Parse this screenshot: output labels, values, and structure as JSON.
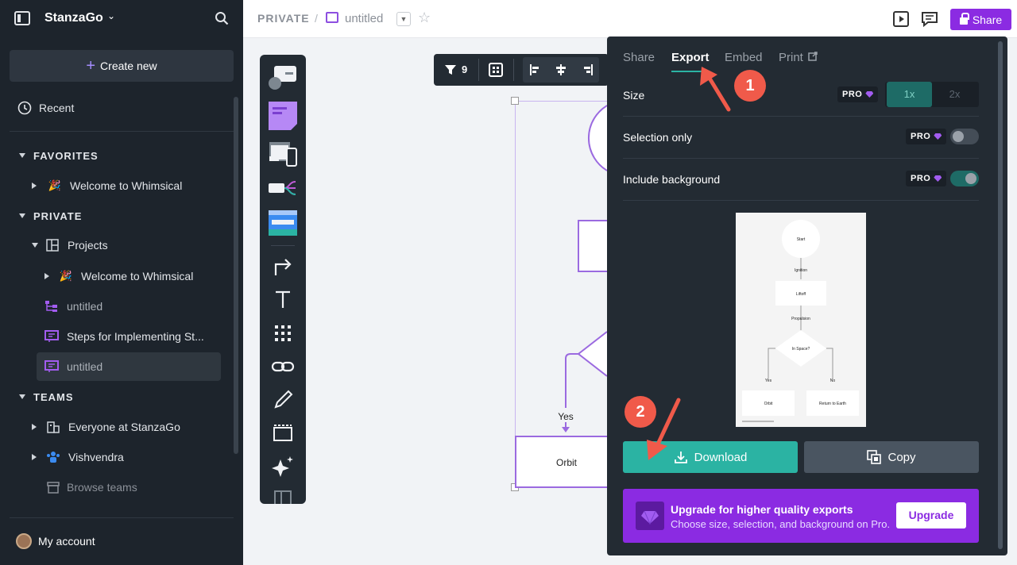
{
  "sidebar": {
    "brand": "StanzaGo",
    "create_new": "Create new",
    "recent": "Recent",
    "favorites_header": "FAVORITES",
    "favorites_item": "Welcome to Whimsical",
    "private_header": "PRIVATE",
    "projects": "Projects",
    "projects_welcome": "Welcome to Whimsical",
    "untitled_flow": "untitled",
    "steps": "Steps for Implementing St...",
    "untitled_board": "untitled",
    "teams_header": "TEAMS",
    "everyone": "Everyone at StanzaGo",
    "vishvendra": "Vishvendra",
    "browse_teams": "Browse teams",
    "my_account": "My account"
  },
  "topbar": {
    "breadcrumb": "PRIVATE",
    "slash": "/",
    "doc_title": "untitled",
    "share": "Share"
  },
  "canvas": {
    "filter_count": "9",
    "yes_label": "Yes",
    "orbit_label": "Orbit"
  },
  "panel": {
    "tabs": [
      "Share",
      "Export",
      "Embed",
      "Print"
    ],
    "size_label": "Size",
    "pro": "PRO",
    "size_options": [
      "1x",
      "2x"
    ],
    "selection_only": "Selection only",
    "include_background": "Include background",
    "download": "Download",
    "copy": "Copy",
    "upgrade_title": "Upgrade for higher quality exports",
    "upgrade_sub": "Choose size, selection, and background on Pro.",
    "upgrade_btn": "Upgrade"
  },
  "preview": {
    "start": "Start",
    "ignition": "Ignition",
    "liftoff": "Liftoff",
    "propulsion": "Propulsion",
    "in_space": "In Space?",
    "yes": "Yes",
    "no": "No",
    "orbit": "Orbit",
    "return": "Return to Earth"
  },
  "annotations": [
    "1",
    "2"
  ],
  "colors": {
    "accent_purple": "#8b2be2",
    "teal": "#2bb3a3",
    "annotation_red": "#f05a4a",
    "sidebar_bg": "#1d242c"
  }
}
